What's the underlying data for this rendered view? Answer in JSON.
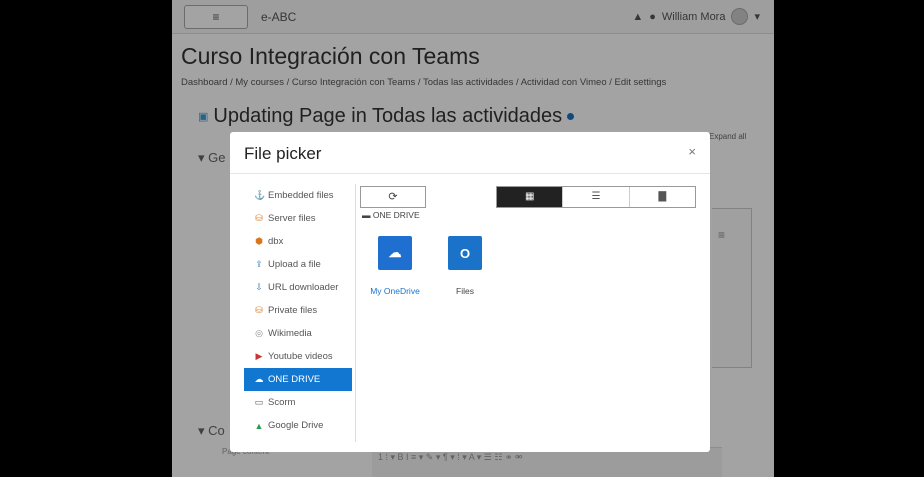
{
  "topbar": {
    "menu_icon": "hamburger-icon",
    "menu_glyph": "≡",
    "site_name": "e-ABC",
    "user_name": "William Mora",
    "bell_glyph": "▲",
    "chat_glyph": "●",
    "caret": "▾"
  },
  "course": {
    "title": "Curso Integración con Teams",
    "breadcrumb": "Dashboard / My courses / Curso Integración con Teams / Todas las actividades / Actividad con Vimeo / Edit settings"
  },
  "page": {
    "heading": "Updating Page in Todas las actividades",
    "heading_icon": "page-icon",
    "expand_all": "Expand all",
    "section_general": "Ge",
    "section_content": "Co",
    "content_sub": "Page content",
    "toolbar_text": "1  ⁞ ▾  B  I  ≡ ▾   ✎ ▾  ¶ ▾  ⁞ ▾  A ▾  ☰  ☷  ⚭  ⚮"
  },
  "modal": {
    "title": "File picker",
    "close": "×",
    "repositories": [
      {
        "label": "Embedded files",
        "icon": "embedded-files-icon",
        "glyph": "⚓",
        "active": false
      },
      {
        "label": "Server files",
        "icon": "server-files-icon",
        "glyph": "⛁",
        "active": false
      },
      {
        "label": "dbx",
        "icon": "dropbox-icon",
        "glyph": "⬢",
        "active": false
      },
      {
        "label": "Upload a file",
        "icon": "upload-icon",
        "glyph": "⇪",
        "active": false
      },
      {
        "label": "URL downloader",
        "icon": "url-downloader-icon",
        "glyph": "⇩",
        "active": false
      },
      {
        "label": "Private files",
        "icon": "private-files-icon",
        "glyph": "⛁",
        "active": false
      },
      {
        "label": "Wikimedia",
        "icon": "wikimedia-icon",
        "glyph": "◎",
        "active": false
      },
      {
        "label": "Youtube videos",
        "icon": "youtube-icon",
        "glyph": "▶",
        "active": false
      },
      {
        "label": "ONE DRIVE",
        "icon": "onedrive-icon",
        "glyph": "☁",
        "active": true
      },
      {
        "label": "Scorm",
        "icon": "scorm-icon",
        "glyph": "▭",
        "active": false
      },
      {
        "label": "Google Drive",
        "icon": "google-drive-icon",
        "glyph": "▲",
        "active": false
      }
    ],
    "refresh_glyph": "⟳",
    "path": "ONE DRIVE",
    "views": [
      {
        "name": "icons-view",
        "glyph": "▦",
        "active": true
      },
      {
        "name": "list-view",
        "glyph": "☰",
        "active": false
      },
      {
        "name": "tree-view",
        "glyph": "▇",
        "active": false
      }
    ],
    "tiles": [
      {
        "label": "My OneDrive",
        "icon": "onedrive-cloud-icon",
        "glyph": "☁",
        "color": "#1f6fd1"
      },
      {
        "label": "Files",
        "icon": "outlook-files-icon",
        "glyph": "O",
        "color": "#1a73c9"
      }
    ]
  },
  "colors": {
    "accent": "#1177d1",
    "view_active": "#222222"
  }
}
